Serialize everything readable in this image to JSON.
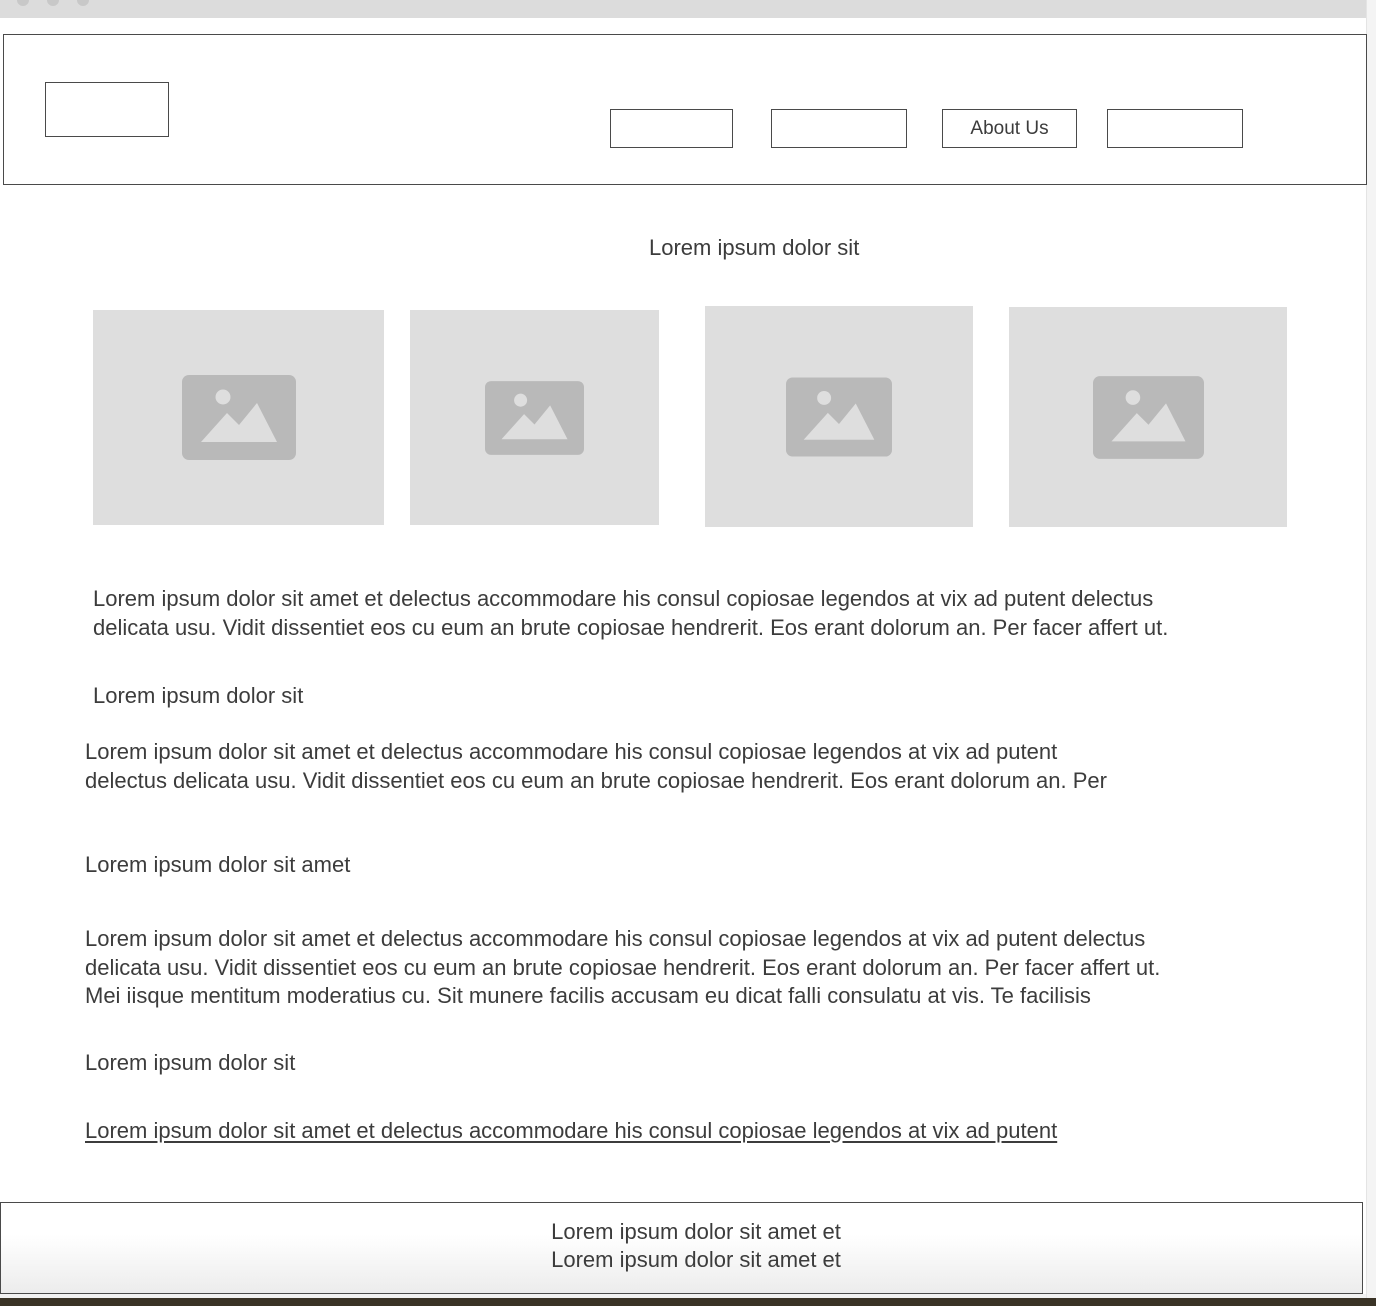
{
  "header": {
    "nav": [
      {
        "label": ""
      },
      {
        "label": ""
      },
      {
        "label": "About Us"
      },
      {
        "label": ""
      }
    ]
  },
  "main": {
    "section_title": "Lorem ipsum dolor sit",
    "images": [
      {
        "icon": "image-placeholder-icon"
      },
      {
        "icon": "image-placeholder-icon"
      },
      {
        "icon": "image-placeholder-icon"
      },
      {
        "icon": "image-placeholder-icon"
      }
    ],
    "intro": [
      "Lorem ipsum dolor sit amet et delectus accommodare his consul copiosae legendos at vix ad putent delectus",
      "delicata usu. Vidit dissentiet eos cu eum an brute copiosae hendrerit. Eos erant dolorum an. Per facer affert ut."
    ],
    "heading1": "Lorem ipsum dolor sit",
    "para1": [
      "Lorem ipsum dolor sit amet et delectus accommodare his consul copiosae legendos at vix ad putent",
      "delectus delicata usu. Vidit dissentiet eos cu eum an brute copiosae hendrerit. Eos erant dolorum an. Per"
    ],
    "heading2": "Lorem ipsum dolor sit amet",
    "para2": [
      "Lorem ipsum dolor sit amet et delectus accommodare his consul copiosae legendos at vix ad putent delectus",
      "delicata usu. Vidit dissentiet eos cu eum an brute copiosae hendrerit. Eos erant dolorum an. Per facer affert ut.",
      "Mei iisque mentitum moderatius cu. Sit munere facilis accusam eu dicat falli consulatu at vis. Te facilisis"
    ],
    "heading3": "Lorem ipsum dolor sit",
    "link": "Lorem ipsum dolor sit amet et delectus accommodare his consul copiosae legendos at vix ad putent"
  },
  "footer": {
    "lines": [
      "Lorem ipsum dolor sit amet et",
      "Lorem ipsum dolor sit amet et"
    ]
  },
  "colors": {
    "text": "#3c3c3c",
    "border": "#4a4a4a",
    "placeholder_bg": "#dedede",
    "placeholder_icon": "#b9b9b9"
  }
}
